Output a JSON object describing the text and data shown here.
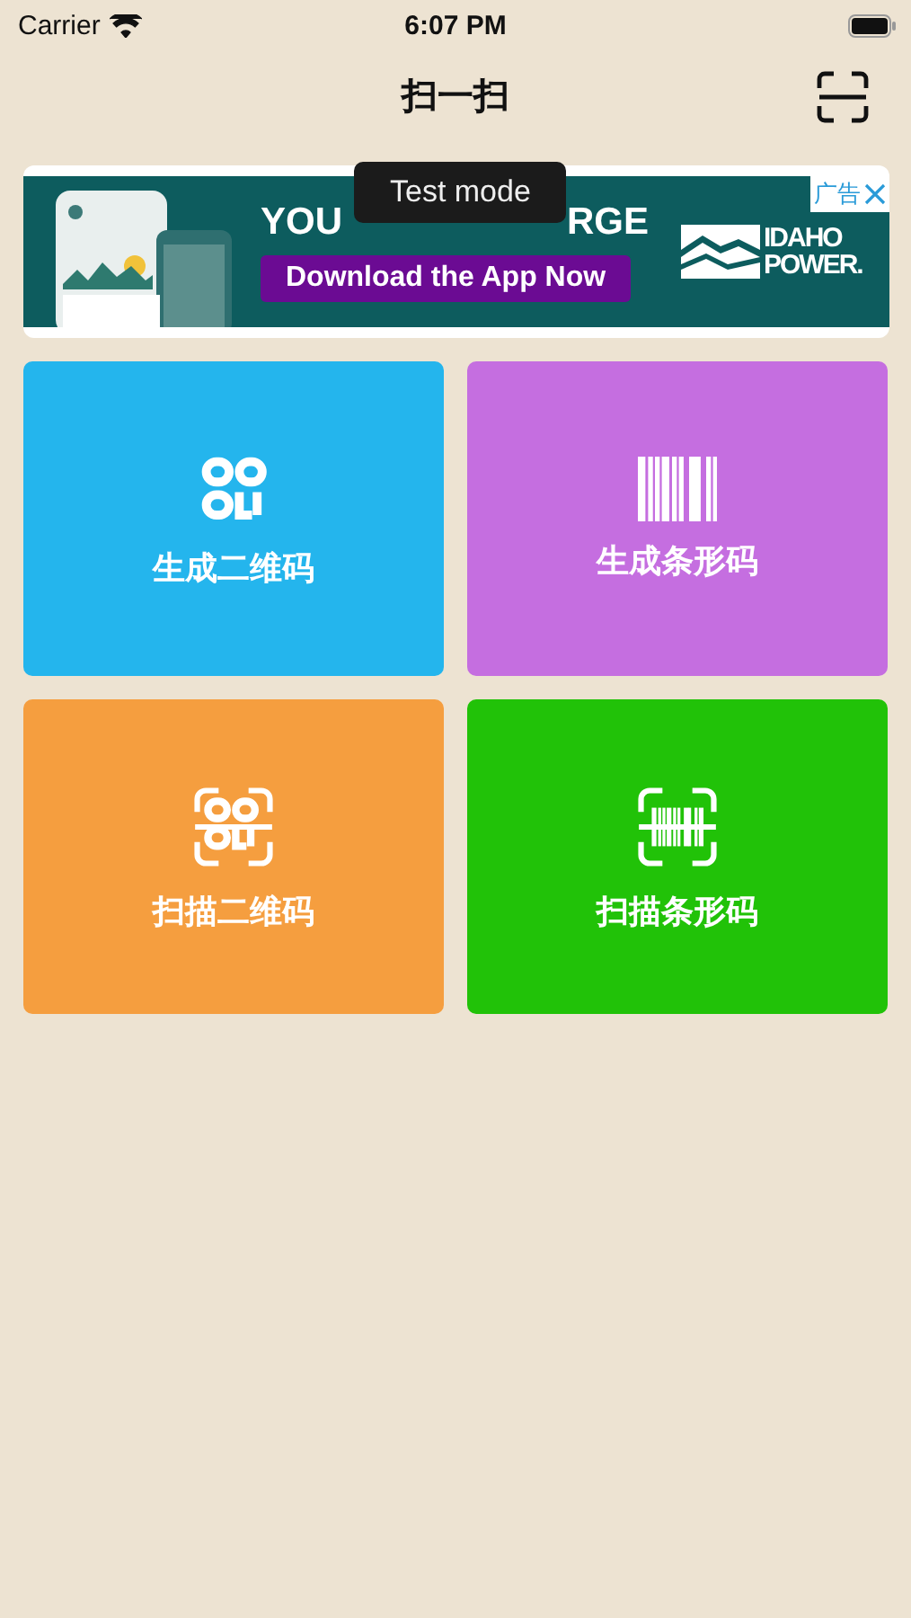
{
  "status_bar": {
    "carrier": "Carrier",
    "time": "6:07 PM"
  },
  "nav": {
    "title": "扫一扫"
  },
  "ad": {
    "headline_left": "YOU",
    "headline_right": "RGE",
    "cta": "Download the App Now",
    "ad_label": "广告",
    "brand_line1": "IDAHO",
    "brand_line2": "POWER.",
    "tooltip": "Test mode"
  },
  "tiles": [
    {
      "label": "生成二维码",
      "kind": "qr",
      "color": "#24b5ed"
    },
    {
      "label": "生成条形码",
      "kind": "barcode",
      "color": "#c56ee0"
    },
    {
      "label": "扫描二维码",
      "kind": "scan-qr",
      "color": "#f59e3f"
    },
    {
      "label": "扫描条形码",
      "kind": "scan-barcode",
      "color": "#21c208"
    }
  ]
}
